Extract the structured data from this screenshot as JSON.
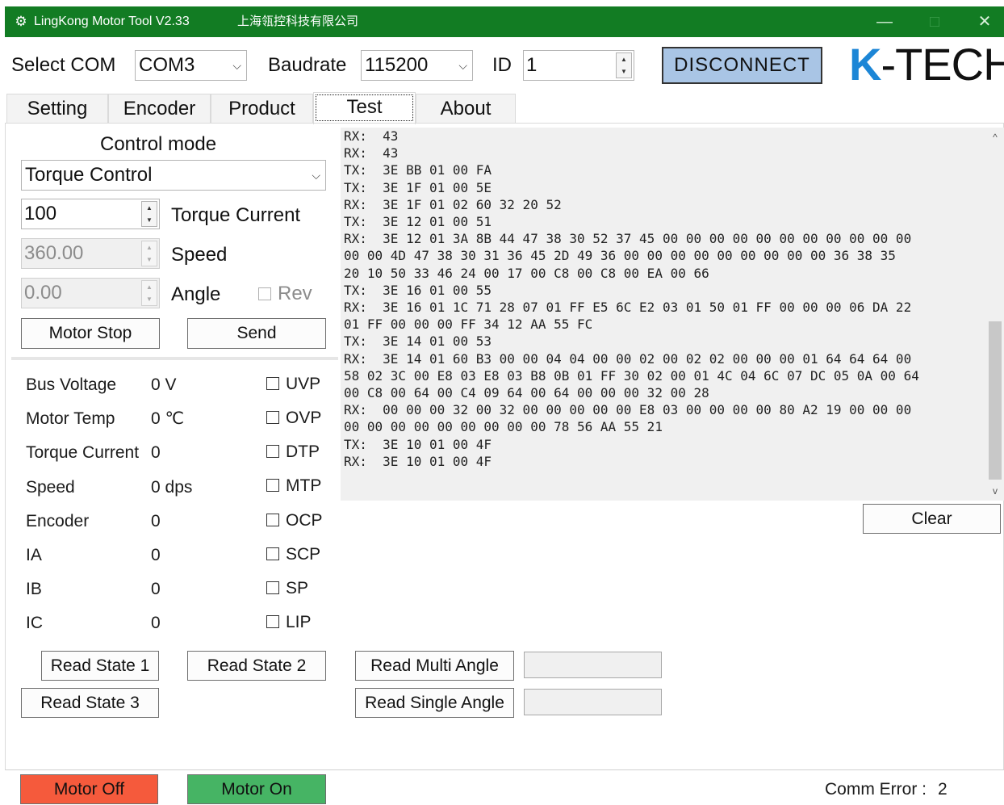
{
  "window": {
    "title": "LingKong Motor Tool V2.33",
    "company": "上海瓴控科技有限公司",
    "minimize": "—",
    "maximize": "□",
    "close": "✕",
    "app_icon": "gear-icon"
  },
  "toolbar": {
    "select_com_label": "Select COM",
    "com_value": "COM3",
    "baudrate_label": "Baudrate",
    "baudrate_value": "115200",
    "id_label": "ID",
    "id_value": "1",
    "disconnect_label": "DISCONNECT",
    "logo_k": "K",
    "logo_rest": "-TECH"
  },
  "tabs": [
    {
      "label": "Setting",
      "active": false
    },
    {
      "label": "Encoder",
      "active": false
    },
    {
      "label": "Product",
      "active": false
    },
    {
      "label": "Test",
      "active": true
    },
    {
      "label": "About",
      "active": false
    }
  ],
  "control": {
    "heading": "Control mode",
    "mode_value": "Torque Control",
    "torque_value": "100",
    "torque_label": "Torque Current",
    "speed_value": "360.00",
    "speed_label": "Speed",
    "angle_value": "0.00",
    "angle_label": "Angle",
    "rev_label": "Rev",
    "motor_stop_label": "Motor Stop",
    "send_label": "Send"
  },
  "status": {
    "bus_voltage": {
      "label": "Bus Voltage",
      "value": "0 V"
    },
    "motor_temp": {
      "label": "Motor Temp",
      "value": "0 ℃"
    },
    "torque_current": {
      "label": "Torque Current",
      "value": "0"
    },
    "speed": {
      "label": "Speed",
      "value": "0 dps"
    },
    "encoder": {
      "label": "Encoder",
      "value": "0"
    },
    "ia": {
      "label": "IA",
      "value": "0"
    },
    "ib": {
      "label": "IB",
      "value": "0"
    },
    "ic": {
      "label": "IC",
      "value": "0"
    }
  },
  "flags": {
    "uvp": "UVP",
    "ovp": "OVP",
    "dtp": "DTP",
    "mtp": "MTP",
    "ocp": "OCP",
    "scp": "SCP",
    "sp": "SP",
    "lip": "LIP"
  },
  "buttons": {
    "read_state_1": "Read State 1",
    "read_state_2": "Read State 2",
    "read_state_3": "Read State 3",
    "read_multi_angle": "Read Multi Angle",
    "read_single_angle": "Read Single Angle",
    "clear": "Clear",
    "motor_off": "Motor Off",
    "motor_on": "Motor On"
  },
  "comm_error": {
    "label": "Comm Error :",
    "value": "2"
  },
  "colors": {
    "titlebar": "#127c23",
    "disconnect_bg": "#a9c5e5",
    "motor_off_bg": "#f55a3c",
    "motor_on_bg": "#46b464",
    "logo_k": "#1c86d6"
  },
  "log": [
    "RX:  43",
    "RX:  43",
    "TX:  3E BB 01 00 FA",
    "TX:  3E 1F 01 00 5E",
    "RX:  3E 1F 01 02 60 32 20 52",
    "TX:  3E 12 01 00 51",
    "RX:  3E 12 01 3A 8B 44 47 38 30 52 37 45 00 00 00 00 00 00 00 00 00 00 00",
    "00 00 4D 47 38 30 31 36 45 2D 49 36 00 00 00 00 00 00 00 00 00 36 38 35",
    "20 10 50 33 46 24 00 17 00 C8 00 C8 00 EA 00 66",
    "TX:  3E 16 01 00 55",
    "RX:  3E 16 01 1C 71 28 07 01 FF E5 6C E2 03 01 50 01 FF 00 00 00 06 DA 22",
    "01 FF 00 00 00 FF 34 12 AA 55 FC",
    "TX:  3E 14 01 00 53",
    "RX:  3E 14 01 60 B3 00 00 04 04 00 00 02 00 02 02 00 00 00 01 64 64 64 00",
    "58 02 3C 00 E8 03 E8 03 B8 0B 01 FF 30 02 00 01 4C 04 6C 07 DC 05 0A 00 64",
    "00 C8 00 64 00 C4 09 64 00 64 00 00 00 32 00 28",
    "RX:  00 00 00 32 00 32 00 00 00 00 00 E8 03 00 00 00 00 80 A2 19 00 00 00",
    "00 00 00 00 00 00 00 00 00 78 56 AA 55 21",
    "TX:  3E 10 01 00 4F",
    "RX:  3E 10 01 00 4F"
  ]
}
